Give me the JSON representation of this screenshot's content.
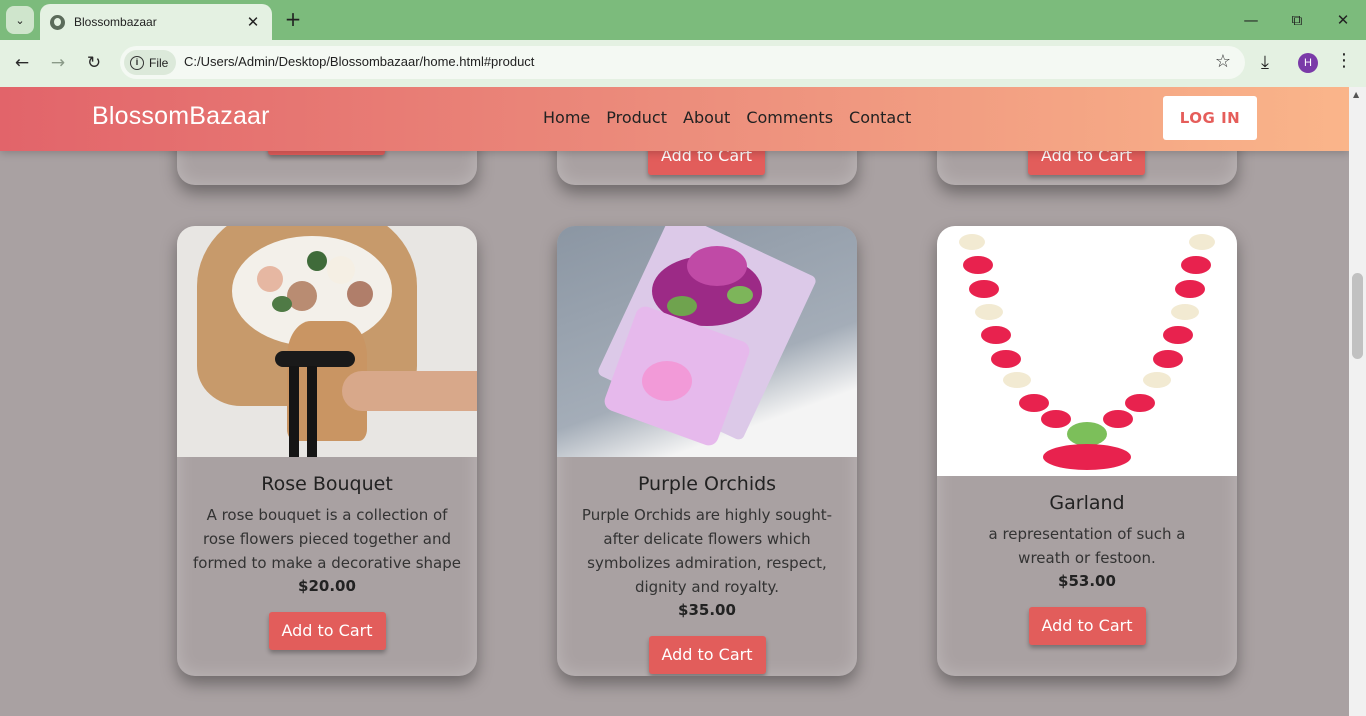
{
  "browser": {
    "tab_title": "Blossombazaar",
    "chip_label": "File",
    "url": "C:/Users/Admin/Desktop/Blossombazaar/home.html#product",
    "profile_initial": "H"
  },
  "site": {
    "brand": "BlossomBazaar",
    "nav": [
      "Home",
      "Product",
      "About",
      "Comments",
      "Contact"
    ],
    "login_label": "LOG IN"
  },
  "top_row": {
    "cart_label": "Add to Cart"
  },
  "products": [
    {
      "name": "Rose Bouquet",
      "description": "A rose bouquet is a collection of rose flowers pieced together and formed to make a decorative shape",
      "price": "$20.00",
      "cart_label": "Add to Cart",
      "image": "rose-bouquet-image"
    },
    {
      "name": "Purple Orchids",
      "description": "Purple Orchids are highly sought-after delicate flowers which symbolizes admiration, respect, dignity and royalty.",
      "price": "$35.00",
      "cart_label": "Add to Cart",
      "image": "purple-orchids-image"
    },
    {
      "name": "Garland",
      "description": "a representation of such a wreath or festoon.",
      "price": "$53.00",
      "cart_label": "Add to Cart",
      "image": "garland-image"
    }
  ],
  "colors": {
    "page_bg": "#a9a1a2",
    "accent": "#e25d5b",
    "nav_gradient_start": "#e2646a",
    "nav_gradient_end": "#fab58a"
  }
}
